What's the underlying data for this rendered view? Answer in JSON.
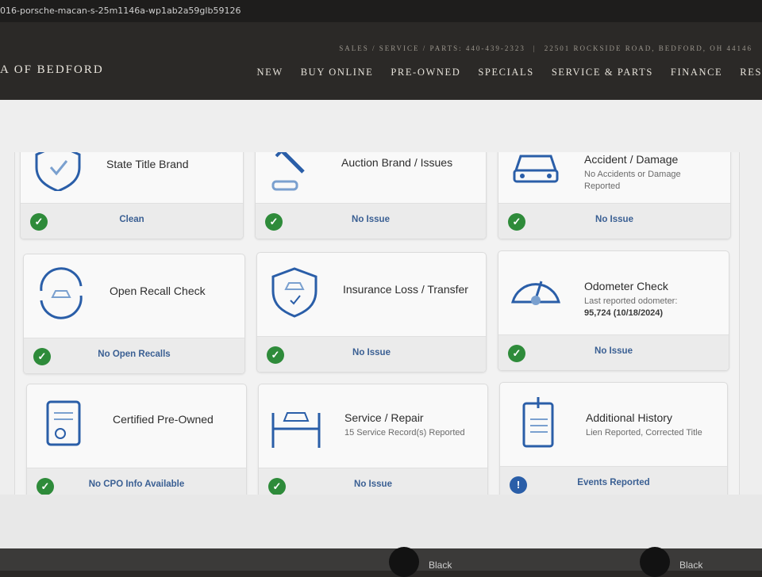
{
  "browser": {
    "url_fragment": "016-porsche-macan-s-25m1146a-wp1ab2a59glb59126"
  },
  "header": {
    "brand": "A OF BEDFORD",
    "contact": "SALES / SERVICE / PARTS: 440-439-2323",
    "address": "22501 ROCKSIDE ROAD, BEDFORD, OH 44146",
    "nav": [
      "NEW",
      "BUY ONLINE",
      "PRE-OWNED",
      "SPECIALS",
      "SERVICE & PARTS",
      "FINANCE",
      "RES"
    ]
  },
  "cards": [
    {
      "title": "State Title Brand",
      "sub": "",
      "status": "Clean",
      "status_type": "ok",
      "icon": "shield-check-icon"
    },
    {
      "title": "Auction Brand / Issues",
      "sub": "",
      "status": "No Issue",
      "status_type": "ok",
      "icon": "gavel-icon"
    },
    {
      "title": "Accident / Damage",
      "sub": "No Accidents or Damage Reported",
      "status": "No Issue",
      "status_type": "ok",
      "icon": "car-damage-icon"
    },
    {
      "title": "Open Recall Check",
      "sub": "",
      "status": "No Open Recalls",
      "status_type": "ok",
      "icon": "car-recall-icon"
    },
    {
      "title": "Insurance Loss / Transfer",
      "sub": "",
      "status": "No Issue",
      "status_type": "ok",
      "icon": "shield-car-icon"
    },
    {
      "title": "Odometer Check",
      "sub": "Last reported odometer:",
      "sub_strong": "95,724 (10/18/2024)",
      "status": "No Issue",
      "status_type": "ok",
      "icon": "odometer-icon"
    },
    {
      "title": "Certified Pre-Owned",
      "sub": "",
      "status": "No CPO Info Available",
      "status_type": "ok",
      "icon": "certificate-icon"
    },
    {
      "title": "Service / Repair",
      "sub": "15 Service Record(s) Reported",
      "status": "No Issue",
      "status_type": "ok",
      "icon": "car-lift-icon"
    },
    {
      "title": "Additional History",
      "sub": "Lien Reported, Corrected Title",
      "status": "Events Reported",
      "status_type": "warn",
      "icon": "clipboard-alert-icon"
    }
  ],
  "footer_swatches": [
    "Black",
    "Black"
  ],
  "colors": {
    "accent": "#2a5ea8",
    "ok": "#2e8b3a",
    "text_link": "#3a5f93",
    "header_bg": "#2b2927"
  }
}
